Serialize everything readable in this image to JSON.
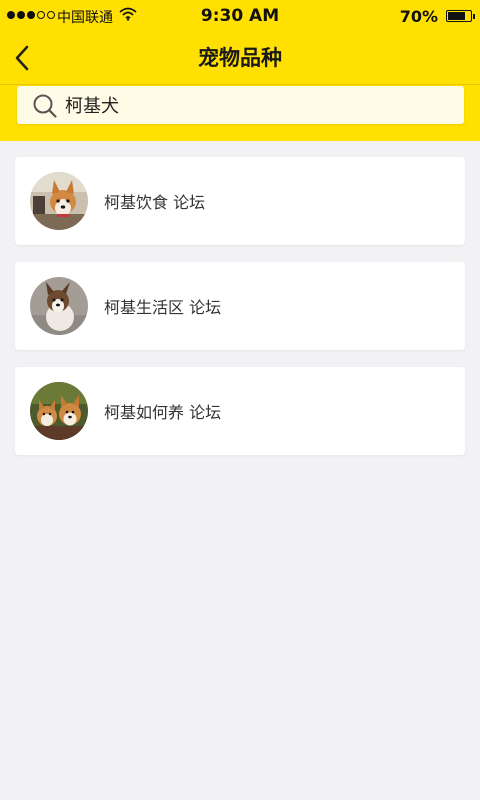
{
  "status_bar": {
    "carrier": "中国联通",
    "time": "9:30 AM",
    "battery": "70%",
    "battery_level": 0.7
  },
  "nav": {
    "title": "宠物品种"
  },
  "search": {
    "value": "柯基犬"
  },
  "forums": [
    {
      "label": "柯基饮食 论坛",
      "avatar": "corgi-photo"
    },
    {
      "label": "柯基生活区 论坛",
      "avatar": "corgi-photo"
    },
    {
      "label": "柯基如何养 论坛",
      "avatar": "corgi-photo"
    }
  ],
  "colors": {
    "header": "#ffe000",
    "background": "#f2f1f4",
    "search_bg": "#fffbe6"
  }
}
